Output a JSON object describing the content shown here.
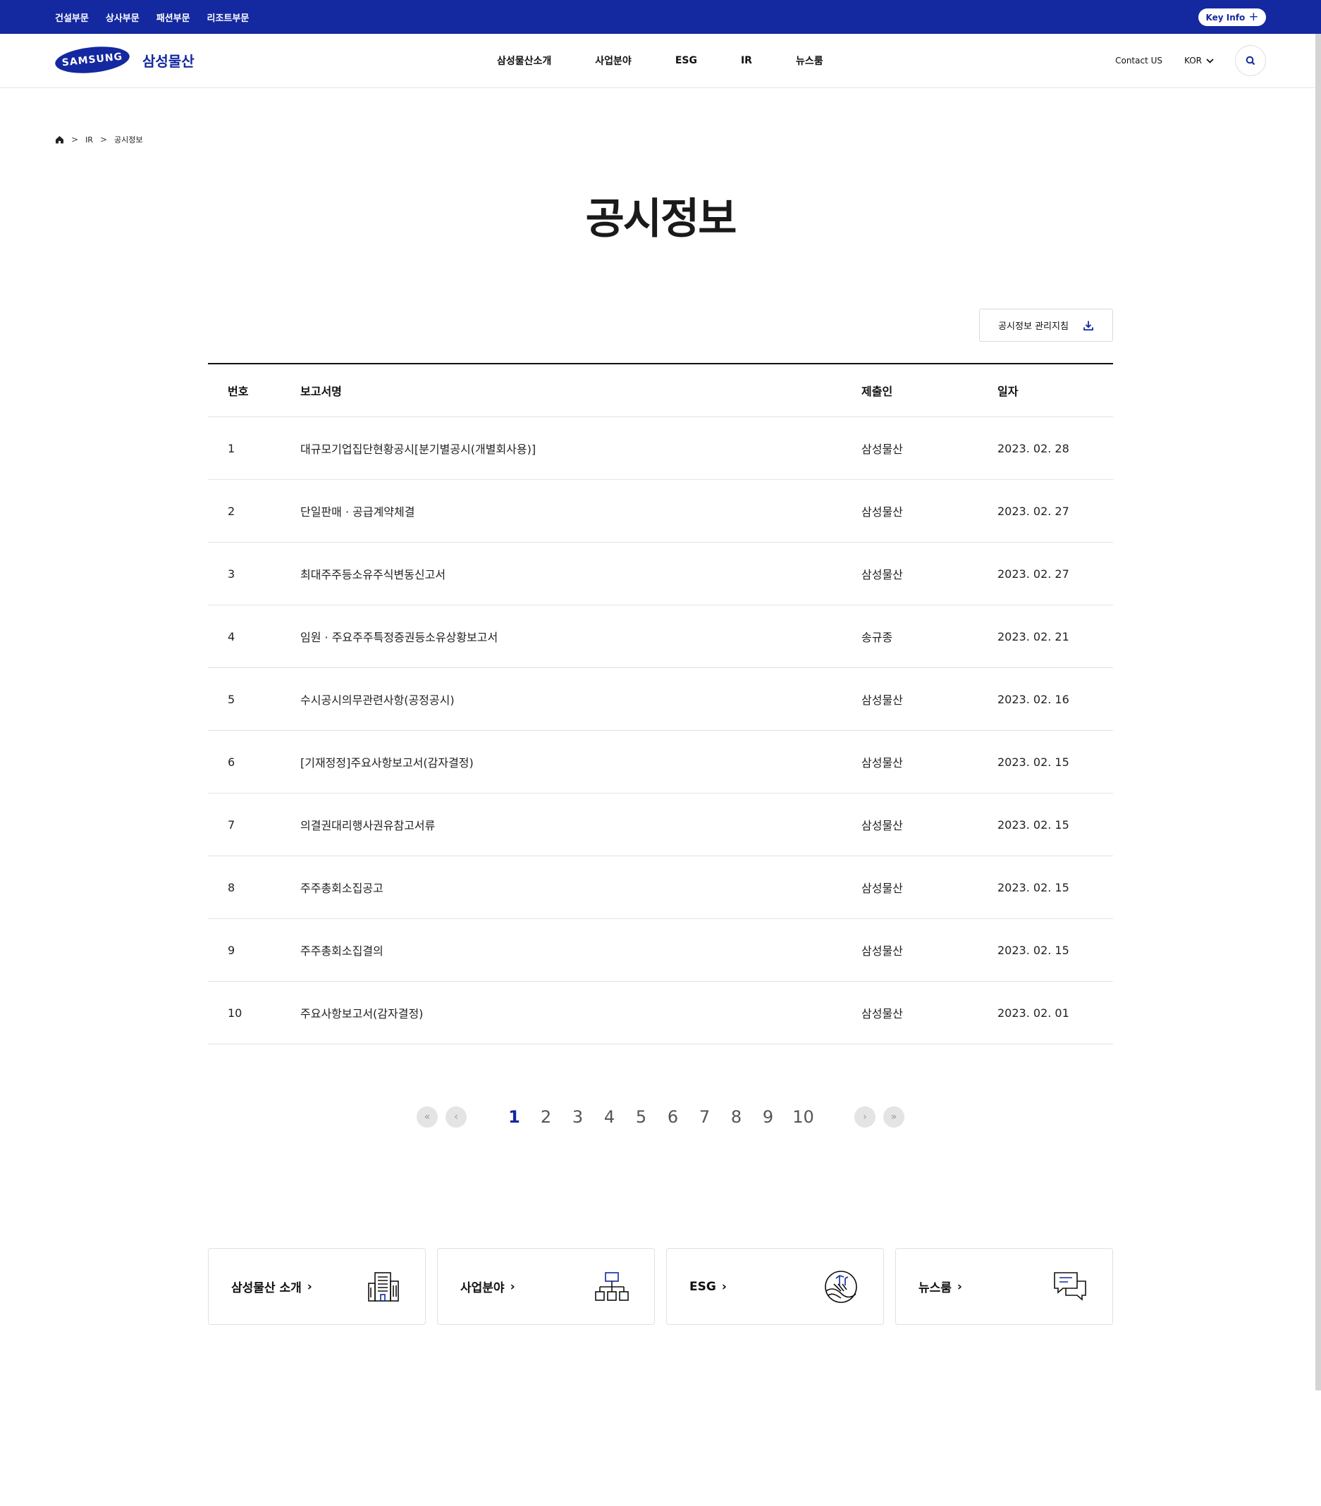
{
  "topbar": {
    "divisions": [
      "건설부문",
      "상사부문",
      "패션부문",
      "리조트부문"
    ],
    "key_info": "Key Info"
  },
  "header": {
    "logo_text": "SAMSUNG",
    "company_name": "삼성물산",
    "nav": [
      "삼성물산소개",
      "사업분야",
      "ESG",
      "IR",
      "뉴스룸"
    ],
    "contact": "Contact US",
    "lang": "KOR"
  },
  "breadcrumb": [
    "IR",
    "공시정보"
  ],
  "page_title": "공시정보",
  "guide_button": "공시정보 관리지침",
  "table": {
    "headers": [
      "번호",
      "보고서명",
      "제출인",
      "일자"
    ],
    "rows": [
      [
        "1",
        "대규모기업집단현황공시[분기별공시(개별회사용)]",
        "삼성물산",
        "2023. 02. 28"
      ],
      [
        "2",
        "단일판매 · 공급계약체결",
        "삼성물산",
        "2023. 02. 27"
      ],
      [
        "3",
        "최대주주등소유주식변동신고서",
        "삼성물산",
        "2023. 02. 27"
      ],
      [
        "4",
        "임원 · 주요주주특정증권등소유상황보고서",
        "송규종",
        "2023. 02. 21"
      ],
      [
        "5",
        "수시공시의무관련사항(공정공시)",
        "삼성물산",
        "2023. 02. 16"
      ],
      [
        "6",
        "[기재정정]주요사항보고서(감자결정)",
        "삼성물산",
        "2023. 02. 15"
      ],
      [
        "7",
        "의결권대리행사권유참고서류",
        "삼성물산",
        "2023. 02. 15"
      ],
      [
        "8",
        "주주총회소집공고",
        "삼성물산",
        "2023. 02. 15"
      ],
      [
        "9",
        "주주총회소집결의",
        "삼성물산",
        "2023. 02. 15"
      ],
      [
        "10",
        "주요사항보고서(감자결정)",
        "삼성물산",
        "2023. 02. 01"
      ]
    ]
  },
  "pagination": {
    "pages": [
      "1",
      "2",
      "3",
      "4",
      "5",
      "6",
      "7",
      "8",
      "9",
      "10"
    ],
    "current": "1"
  },
  "cards": [
    "삼성물산 소개",
    "사업분야",
    "ESG",
    "뉴스룸"
  ],
  "colors": {
    "brand": "#1428a0"
  }
}
